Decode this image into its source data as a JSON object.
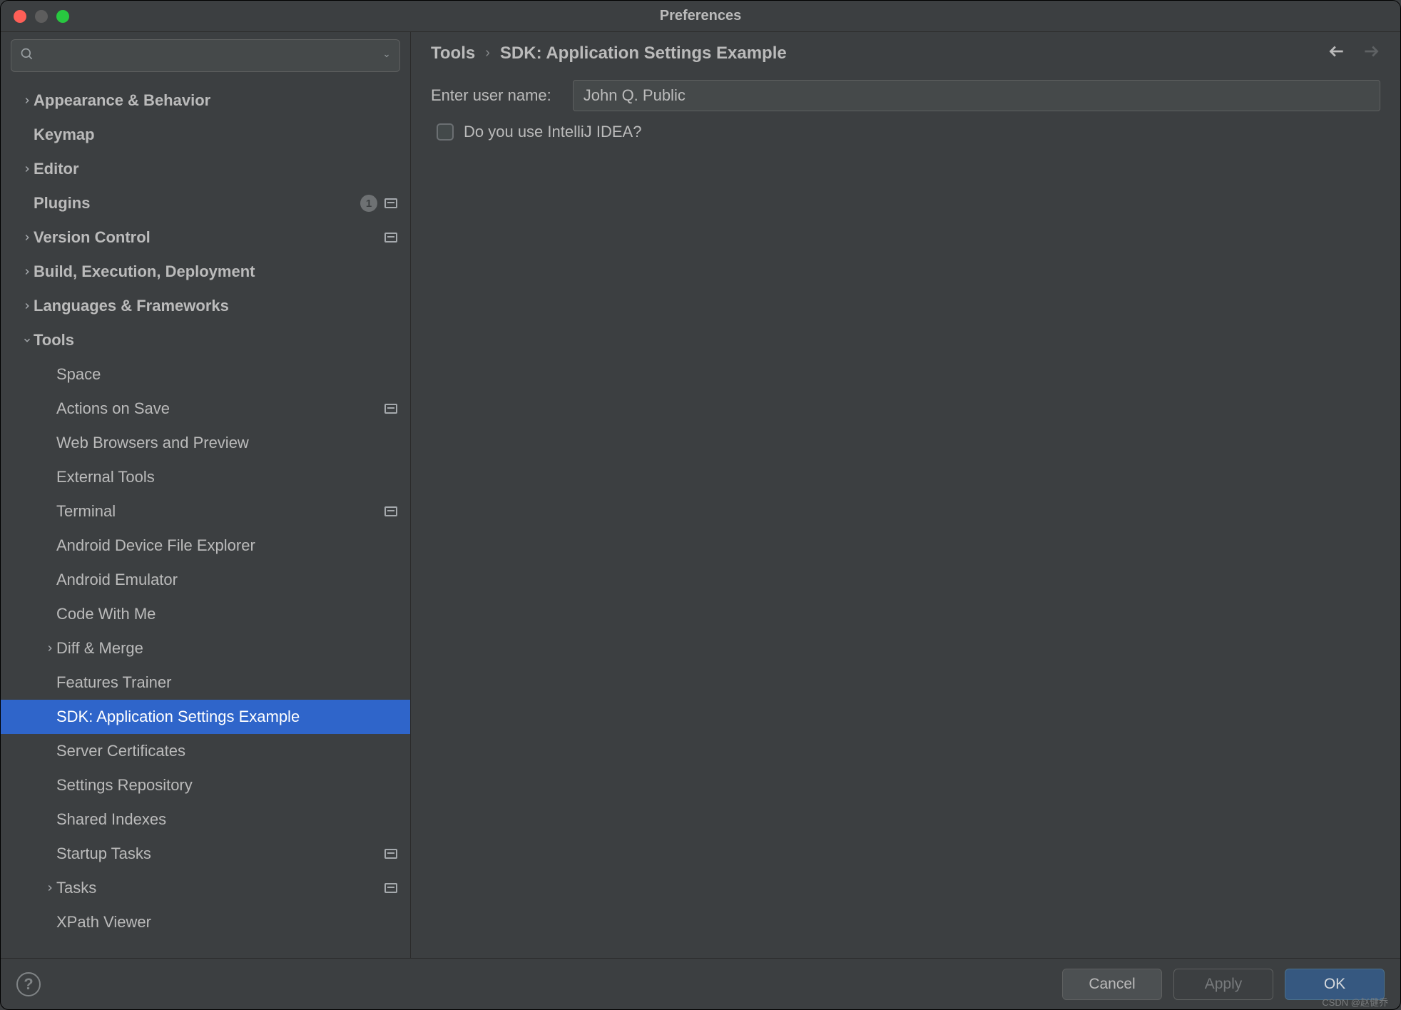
{
  "window": {
    "title": "Preferences"
  },
  "breadcrumb": {
    "crumb0": "Tools",
    "crumb1": "SDK: Application Settings Example"
  },
  "sidebar": {
    "search_placeholder": "",
    "items": [
      {
        "label": "Appearance & Behavior",
        "bold": true,
        "chevron": "right",
        "indent": 0
      },
      {
        "label": "Keymap",
        "bold": true,
        "chevron": "",
        "indent": 0
      },
      {
        "label": "Editor",
        "bold": true,
        "chevron": "right",
        "indent": 0
      },
      {
        "label": "Plugins",
        "bold": true,
        "chevron": "",
        "indent": 0,
        "count": "1",
        "proj": true
      },
      {
        "label": "Version Control",
        "bold": true,
        "chevron": "right",
        "indent": 0,
        "proj": true
      },
      {
        "label": "Build, Execution, Deployment",
        "bold": true,
        "chevron": "right",
        "indent": 0
      },
      {
        "label": "Languages & Frameworks",
        "bold": true,
        "chevron": "right",
        "indent": 0
      },
      {
        "label": "Tools",
        "bold": true,
        "chevron": "down",
        "indent": 0
      },
      {
        "label": "Space",
        "bold": false,
        "chevron": "",
        "indent": 1
      },
      {
        "label": "Actions on Save",
        "bold": false,
        "chevron": "",
        "indent": 1,
        "proj": true
      },
      {
        "label": "Web Browsers and Preview",
        "bold": false,
        "chevron": "",
        "indent": 1
      },
      {
        "label": "External Tools",
        "bold": false,
        "chevron": "",
        "indent": 1
      },
      {
        "label": "Terminal",
        "bold": false,
        "chevron": "",
        "indent": 1,
        "proj": true
      },
      {
        "label": "Android Device File Explorer",
        "bold": false,
        "chevron": "",
        "indent": 1
      },
      {
        "label": "Android Emulator",
        "bold": false,
        "chevron": "",
        "indent": 1
      },
      {
        "label": "Code With Me",
        "bold": false,
        "chevron": "",
        "indent": 1
      },
      {
        "label": "Diff & Merge",
        "bold": false,
        "chevron": "right",
        "indent": 1
      },
      {
        "label": "Features Trainer",
        "bold": false,
        "chevron": "",
        "indent": 1
      },
      {
        "label": "SDK: Application Settings Example",
        "bold": false,
        "chevron": "",
        "indent": 1,
        "selected": true
      },
      {
        "label": "Server Certificates",
        "bold": false,
        "chevron": "",
        "indent": 1
      },
      {
        "label": "Settings Repository",
        "bold": false,
        "chevron": "",
        "indent": 1
      },
      {
        "label": "Shared Indexes",
        "bold": false,
        "chevron": "",
        "indent": 1
      },
      {
        "label": "Startup Tasks",
        "bold": false,
        "chevron": "",
        "indent": 1,
        "proj": true
      },
      {
        "label": "Tasks",
        "bold": false,
        "chevron": "right",
        "indent": 1,
        "proj": true
      },
      {
        "label": "XPath Viewer",
        "bold": false,
        "chevron": "",
        "indent": 1
      }
    ]
  },
  "form": {
    "username_label": "Enter user name:",
    "username_value": "John Q. Public",
    "checkbox_label": "Do you use IntelliJ IDEA?"
  },
  "buttons": {
    "cancel": "Cancel",
    "apply": "Apply",
    "ok": "OK"
  },
  "watermark": "CSDN @赵健乔"
}
